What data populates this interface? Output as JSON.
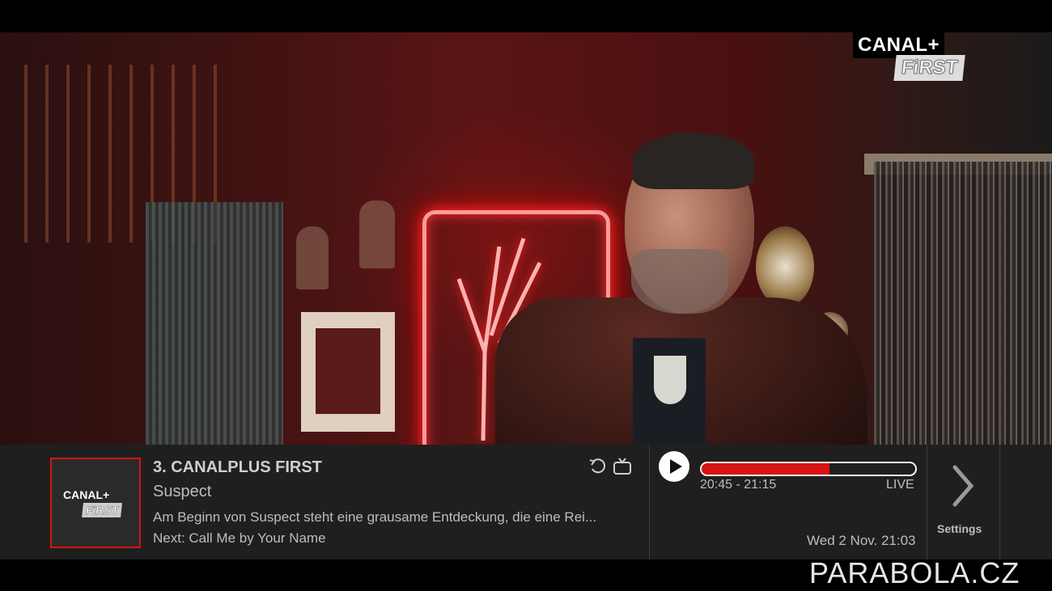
{
  "video": {
    "channel_logo": {
      "line1": "CANAL+",
      "line2": "FiRST"
    }
  },
  "info_bar": {
    "thumbnail": {
      "line1": "CANAL+",
      "line2": "FiRST"
    },
    "channel_name": "3. CANALPLUS FIRST",
    "program_title": "Suspect",
    "description": "Am Beginn von Suspect steht eine grausame Entdeckung, die eine Rei...",
    "next_program": "Next: Call Me by Your Name",
    "icons": [
      "replay-icon",
      "tv-icon"
    ],
    "player": {
      "play_icon": "play-icon",
      "progress": 0.6,
      "time_range": "20:45 - 21:15",
      "live_label": "LIVE",
      "clock": "Wed 2 Nov. 21:03",
      "accent_color": "#d81212"
    },
    "settings": {
      "icon": "chevron-right-icon",
      "label": "Settings"
    }
  },
  "watermark": "PARABOLA.CZ"
}
